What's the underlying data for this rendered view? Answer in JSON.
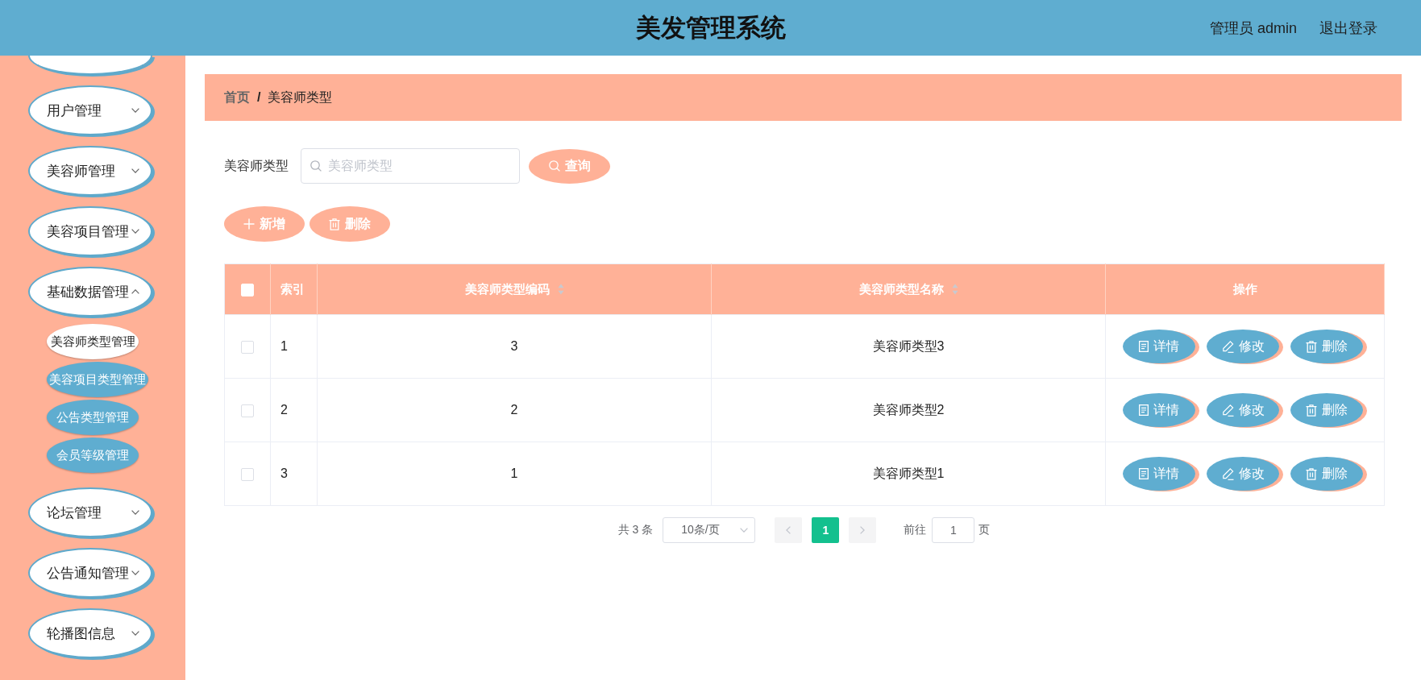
{
  "header": {
    "title": "美发管理系统",
    "user": "管理员 admin",
    "logout": "退出登录"
  },
  "sidebar": {
    "items": [
      {
        "label": "用户管理",
        "expanded": false
      },
      {
        "label": "美容师管理",
        "expanded": false
      },
      {
        "label": "美容项目管理",
        "expanded": false
      },
      {
        "label": "基础数据管理",
        "expanded": true,
        "children": [
          {
            "label": "美容师类型管理",
            "selected": true
          },
          {
            "label": "美容项目类型管理",
            "selected": false
          },
          {
            "label": "公告类型管理",
            "selected": false
          },
          {
            "label": "会员等级管理",
            "selected": false
          }
        ]
      },
      {
        "label": "论坛管理",
        "expanded": false
      },
      {
        "label": "公告通知管理",
        "expanded": false
      },
      {
        "label": "轮播图信息",
        "expanded": false
      }
    ]
  },
  "breadcrumb": {
    "items": [
      "首页",
      "美容师类型"
    ],
    "separator": "/"
  },
  "filter": {
    "label": "美容师类型",
    "search": {
      "placeholder": "美容师类型"
    },
    "button": "查询"
  },
  "actions": [
    {
      "kind": "add",
      "label": "新增"
    },
    {
      "kind": "delete",
      "label": "删除"
    }
  ],
  "table": {
    "select_all_checked": false,
    "columns": [
      {
        "kind": "index",
        "label": "索引",
        "sortable": false
      },
      {
        "kind": "field",
        "label": "美容师类型编码",
        "sortable": true
      },
      {
        "kind": "field",
        "label": "美容师类型名称",
        "sortable": true
      },
      {
        "kind": "actions",
        "label": "操作",
        "sortable": false
      }
    ],
    "rows": [
      {
        "checked": false,
        "cells": [
          "1",
          "3",
          "美容师类型3"
        ],
        "actions": [
          {
            "kind": "detail",
            "label": "详情"
          },
          {
            "kind": "edit",
            "label": "修改"
          },
          {
            "kind": "delete",
            "label": "删除"
          }
        ]
      },
      {
        "checked": false,
        "cells": [
          "2",
          "2",
          "美容师类型2"
        ],
        "actions": [
          {
            "kind": "detail",
            "label": "详情"
          },
          {
            "kind": "edit",
            "label": "修改"
          },
          {
            "kind": "delete",
            "label": "删除"
          }
        ]
      },
      {
        "checked": false,
        "cells": [
          "3",
          "1",
          "美容师类型1"
        ],
        "actions": [
          {
            "kind": "detail",
            "label": "详情"
          },
          {
            "kind": "edit",
            "label": "修改"
          },
          {
            "kind": "delete",
            "label": "删除"
          }
        ]
      }
    ]
  },
  "pagination": {
    "total": "共 3 条",
    "page_size": "10条/页",
    "prev_disabled": true,
    "pages": [
      {
        "label": "1",
        "selected": true
      }
    ],
    "next_disabled": true,
    "goto_label": "前往",
    "goto_value": "1",
    "goto_suffix": "页"
  }
}
